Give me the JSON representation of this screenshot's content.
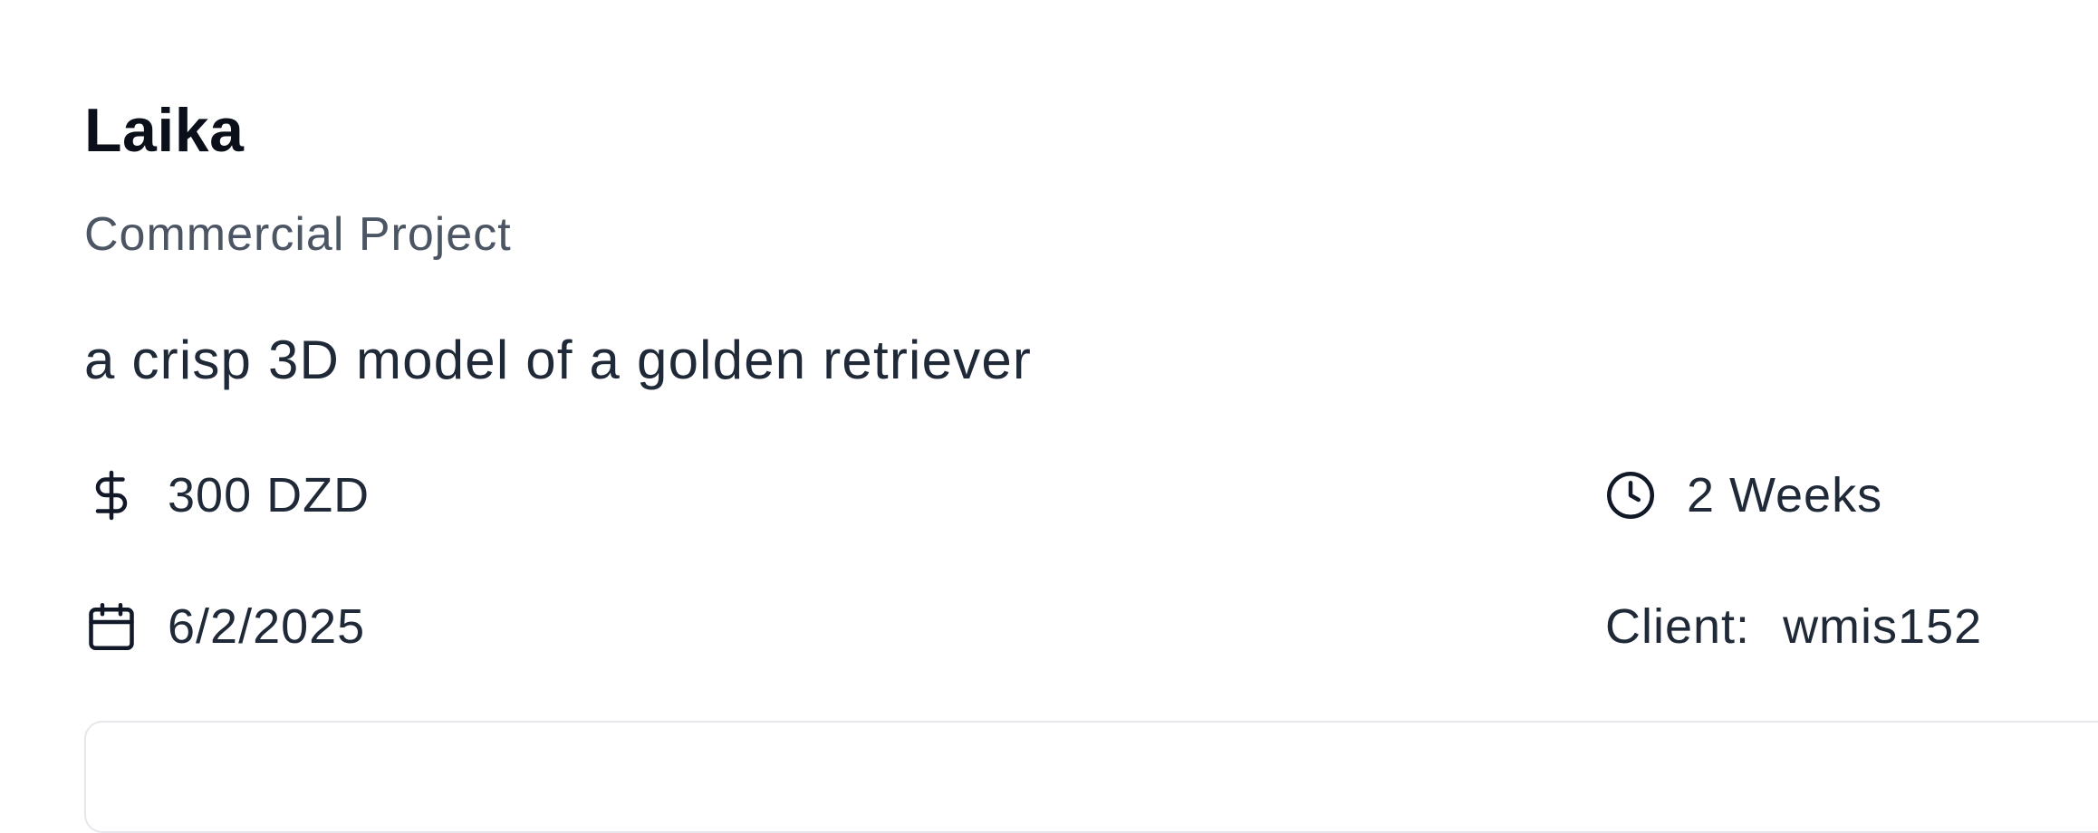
{
  "project": {
    "title": "Laika",
    "type": "Commercial Project",
    "description": "a crisp 3D model of a golden retriever"
  },
  "meta": {
    "budget": "300 DZD",
    "duration": "2 Weeks",
    "date": "6/2/2025",
    "client_label": "Client:",
    "client_value": "wmis152"
  },
  "icons": {
    "budget": "dollar-sign-icon",
    "duration": "clock-icon",
    "date": "calendar-icon"
  }
}
